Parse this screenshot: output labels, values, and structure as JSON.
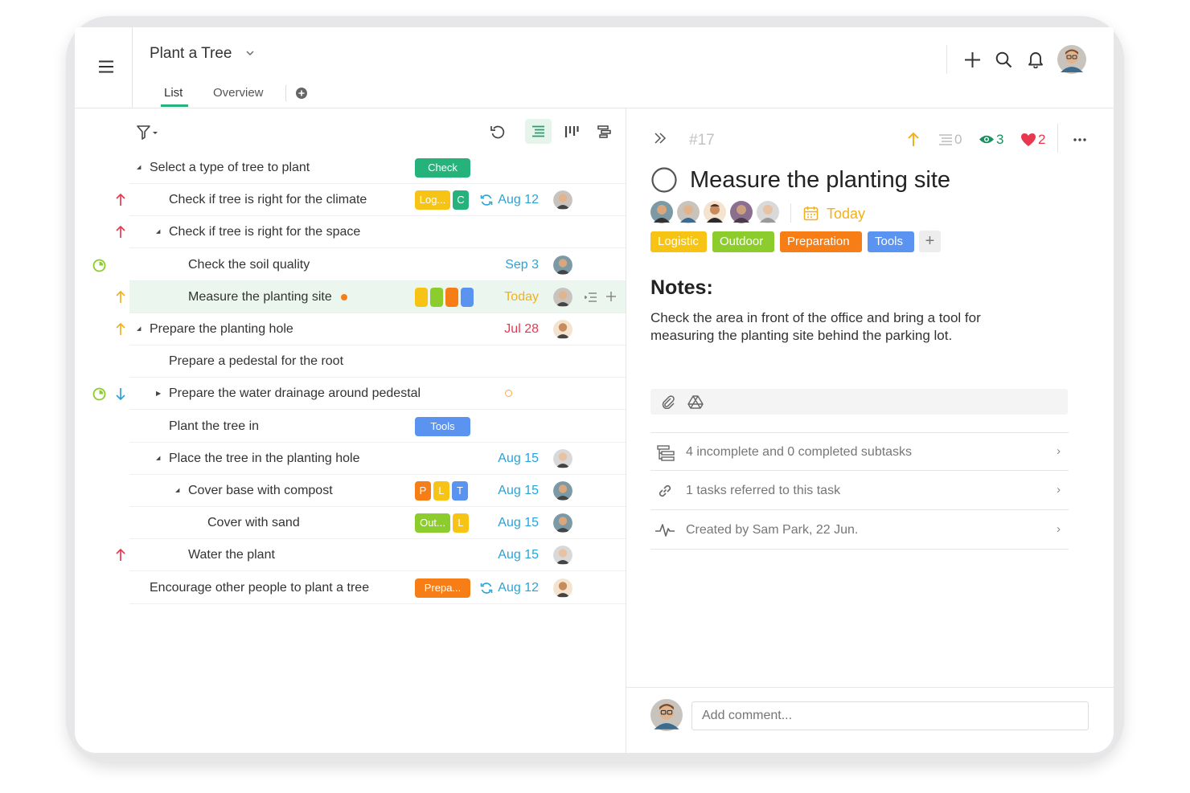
{
  "header": {
    "project_title": "Plant a Tree",
    "tabs": [
      "List",
      "Overview"
    ],
    "active_tab": "List"
  },
  "tasks": [
    {
      "title": "Select a type of tree to plant",
      "tags": [
        {
          "label": "Check",
          "color": "#25b37b"
        }
      ]
    },
    {
      "title": "Check if tree is right for the climate",
      "priority": "high",
      "tags": [
        {
          "label": "Log...",
          "color": "#f7c416"
        },
        {
          "label": "C",
          "color": "#25b37b"
        }
      ],
      "recurring": true,
      "date": "Aug 12"
    },
    {
      "title": "Check if tree is right for the space",
      "priority": "high"
    },
    {
      "title": "Check the soil quality",
      "status": "in-progress",
      "date": "Sep 3"
    },
    {
      "title": "Measure the planting site",
      "priority": "medium",
      "tags": [
        {
          "label": "",
          "color": "#f7c416"
        },
        {
          "label": "",
          "color": "#8ccc2d"
        },
        {
          "label": "",
          "color": "#f77e16"
        },
        {
          "label": "",
          "color": "#5b93f0"
        }
      ],
      "date": "Today",
      "selected": true
    },
    {
      "title": "Prepare the planting hole",
      "priority": "medium",
      "date": "Jul 28"
    },
    {
      "title": "Prepare a pedestal for the root"
    },
    {
      "title": "Prepare the water drainage around pedestal",
      "status": "in-progress",
      "priority": "low"
    },
    {
      "title": "Plant the tree in",
      "tags": [
        {
          "label": "Tools",
          "color": "#5b93f0"
        }
      ]
    },
    {
      "title": "Place the tree in the planting hole",
      "date": "Aug 15"
    },
    {
      "title": "Cover base with compost",
      "tags": [
        {
          "label": "P",
          "color": "#f77e16"
        },
        {
          "label": "L",
          "color": "#f7c416"
        },
        {
          "label": "T",
          "color": "#5b93f0"
        }
      ],
      "date": "Aug 15"
    },
    {
      "title": "Cover with sand",
      "tags": [
        {
          "label": "Out...",
          "color": "#8ccc2d"
        },
        {
          "label": "L",
          "color": "#f7c416"
        }
      ],
      "date": "Aug 15"
    },
    {
      "title": "Water the plant",
      "priority": "high",
      "date": "Aug 15"
    },
    {
      "title": "Encourage other people to plant a tree",
      "tags": [
        {
          "label": "Prepa...",
          "color": "#f77e16"
        }
      ],
      "recurring": true,
      "date": "Aug 12"
    }
  ],
  "detail": {
    "task_id": "#17",
    "subtask_count": "0",
    "watchers": "3",
    "likes": "2",
    "title": "Measure the planting site",
    "due": "Today",
    "tags": [
      {
        "label": "Logistic",
        "color": "#f7c416"
      },
      {
        "label": "Outdoor",
        "color": "#8ccc2d"
      },
      {
        "label": "Preparation",
        "color": "#f77e16"
      },
      {
        "label": "Tools",
        "color": "#5b93f0"
      }
    ],
    "notes_heading": "Notes:",
    "notes": "Check the area in front of the office and bring a tool for measuring the planting site behind the parking lot.",
    "subtasks": "4 incomplete and 0 completed subtasks",
    "references": "1 tasks referred to this task",
    "created": "Created by Sam Park, 22 Jun.",
    "comment_placeholder": "Add comment..."
  },
  "colors": {
    "accent": "#25b37b",
    "date_blue": "#2ba3d6",
    "today": "#f2b01e",
    "overdue": "#e8384f"
  }
}
